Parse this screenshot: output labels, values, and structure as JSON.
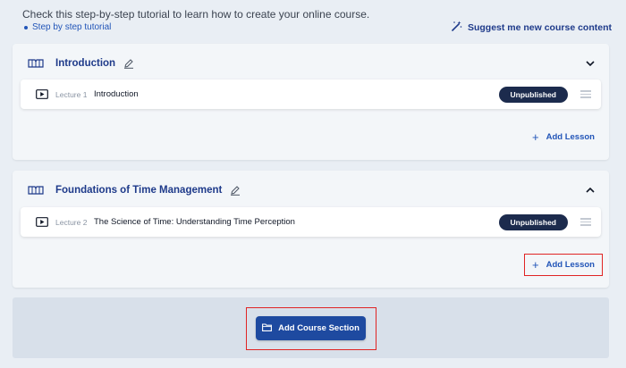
{
  "intro": {
    "text": "Check this step-by-step tutorial to learn how to create your online course.",
    "tutorial_link": "Step by step tutorial"
  },
  "suggest": {
    "label": "Suggest me new course content",
    "icon": "magic-wand-icon"
  },
  "sections": [
    {
      "title": "Introduction",
      "chevron": "chevron-down-icon",
      "lecture": {
        "number": "Lecture 1",
        "title": "Introduction",
        "status": "Unpublished"
      },
      "add_lesson": "Add Lesson"
    },
    {
      "title": "Foundations of Time Management",
      "chevron": "chevron-up-icon",
      "lecture": {
        "number": "Lecture 2",
        "title": "The Science of Time: Understanding Time Perception",
        "status": "Unpublished"
      },
      "add_lesson": "Add Lesson"
    }
  ],
  "footer": {
    "add_section_label": "Add Course Section",
    "icon": "folder-icon"
  },
  "colors": {
    "accent": "#1e4aa0",
    "link": "#2255b8",
    "badge": "#1c2b4d",
    "highlight": "#e02424"
  }
}
